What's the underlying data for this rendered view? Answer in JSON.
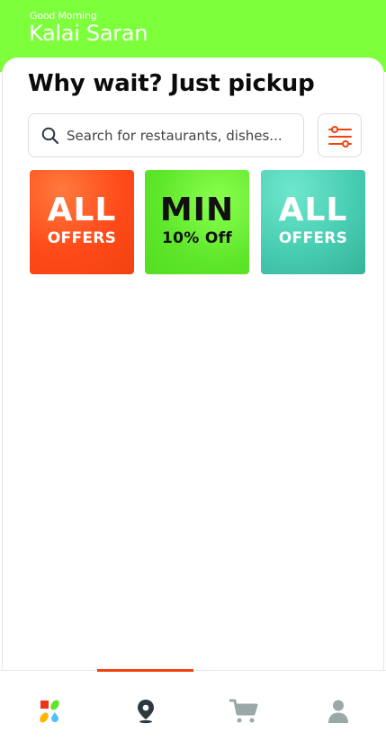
{
  "header": {
    "greeting": "Good Morning",
    "user_name": "Kalai Saran",
    "background_color": "#7dff3b"
  },
  "main": {
    "title": "Why wait? Just pickup"
  },
  "search": {
    "placeholder": "Search for restaurants, dishes...",
    "value": "",
    "icon": "search-icon"
  },
  "filter": {
    "icon": "filter-sliders-icon",
    "color": "#f0420f"
  },
  "offers": [
    {
      "line1": "ALL",
      "line2": "OFFERS",
      "color": "#ff4a1a"
    },
    {
      "line1": "MIN",
      "line2": "10% Off",
      "color": "#5de62a"
    },
    {
      "line1": "ALL",
      "line2": "OFFERS",
      "color": "#48cdb2"
    }
  ],
  "bottom_nav": {
    "active_index": 1,
    "active_color": "#f0420f",
    "items": [
      {
        "name": "home",
        "icon": "colorful-shapes-icon"
      },
      {
        "name": "location",
        "icon": "map-pin-icon"
      },
      {
        "name": "cart",
        "icon": "cart-icon"
      },
      {
        "name": "profile",
        "icon": "user-icon"
      }
    ]
  }
}
